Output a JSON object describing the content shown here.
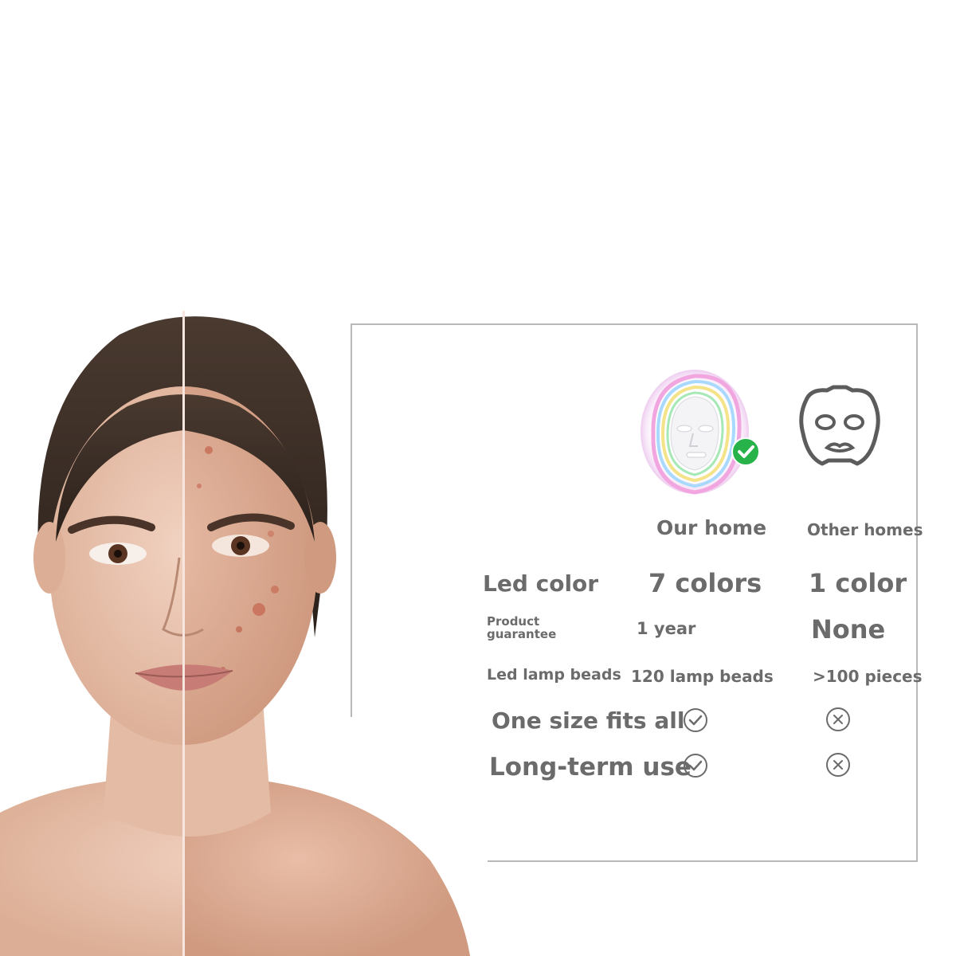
{
  "comparison": {
    "columns": {
      "ours": "Our home",
      "other": "Other homes"
    },
    "rows": [
      {
        "label": "Led color",
        "ours": "7 colors",
        "other": "1 color"
      },
      {
        "label": "Product guarantee",
        "ours": "1 year",
        "other": "None"
      },
      {
        "label": "Led lamp beads",
        "ours": "120 lamp beads",
        "other": ">100 pieces"
      },
      {
        "label": "One size fits all",
        "ours": "check-icon",
        "other": "cross-icon"
      },
      {
        "label": "Long-term use",
        "ours": "check-icon",
        "other": "cross-icon"
      }
    ]
  },
  "colors": {
    "text": "#6b6b6b",
    "accent_green": "#27b34a",
    "frame": "#b8b8b8"
  }
}
